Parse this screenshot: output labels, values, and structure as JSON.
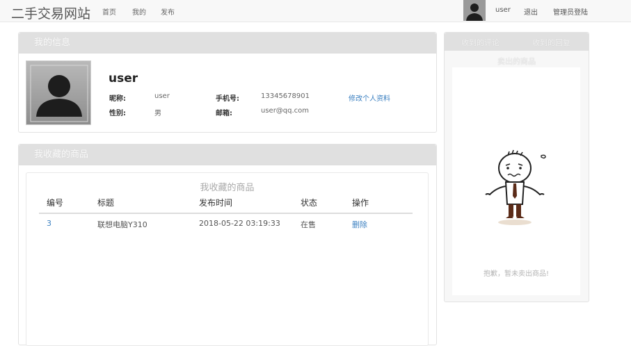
{
  "nav": {
    "brand": "二手交易网站",
    "links": [
      "首页",
      "我的",
      "发布"
    ],
    "username": "user",
    "logout": "退出",
    "admin_login": "管理员登陆"
  },
  "my_info": {
    "heading": "我的信息",
    "username": "user",
    "nickname_label": "昵称:",
    "nickname": "user",
    "phone_label": "手机号:",
    "phone": "13345678901",
    "edit_link": "修改个人资料",
    "gender_label": "性别:",
    "gender": "男",
    "email_label": "邮箱:",
    "email": "user@qq.com"
  },
  "favorites": {
    "heading": "我收藏的商品",
    "table_title": "我收藏的商品",
    "columns": [
      "编号",
      "标题",
      "发布时间",
      "状态",
      "操作"
    ],
    "rows": [
      {
        "id": "3",
        "title": "联想电脑Y310",
        "time": "2018-05-22 03:19:33",
        "status": "在售",
        "action": "删除"
      }
    ]
  },
  "side": {
    "tab_comments": "收到的评论",
    "tab_replies": "收到的回复",
    "sold_title": "卖出的商品",
    "empty_text": "抱歉，暂未卖出商品!"
  }
}
